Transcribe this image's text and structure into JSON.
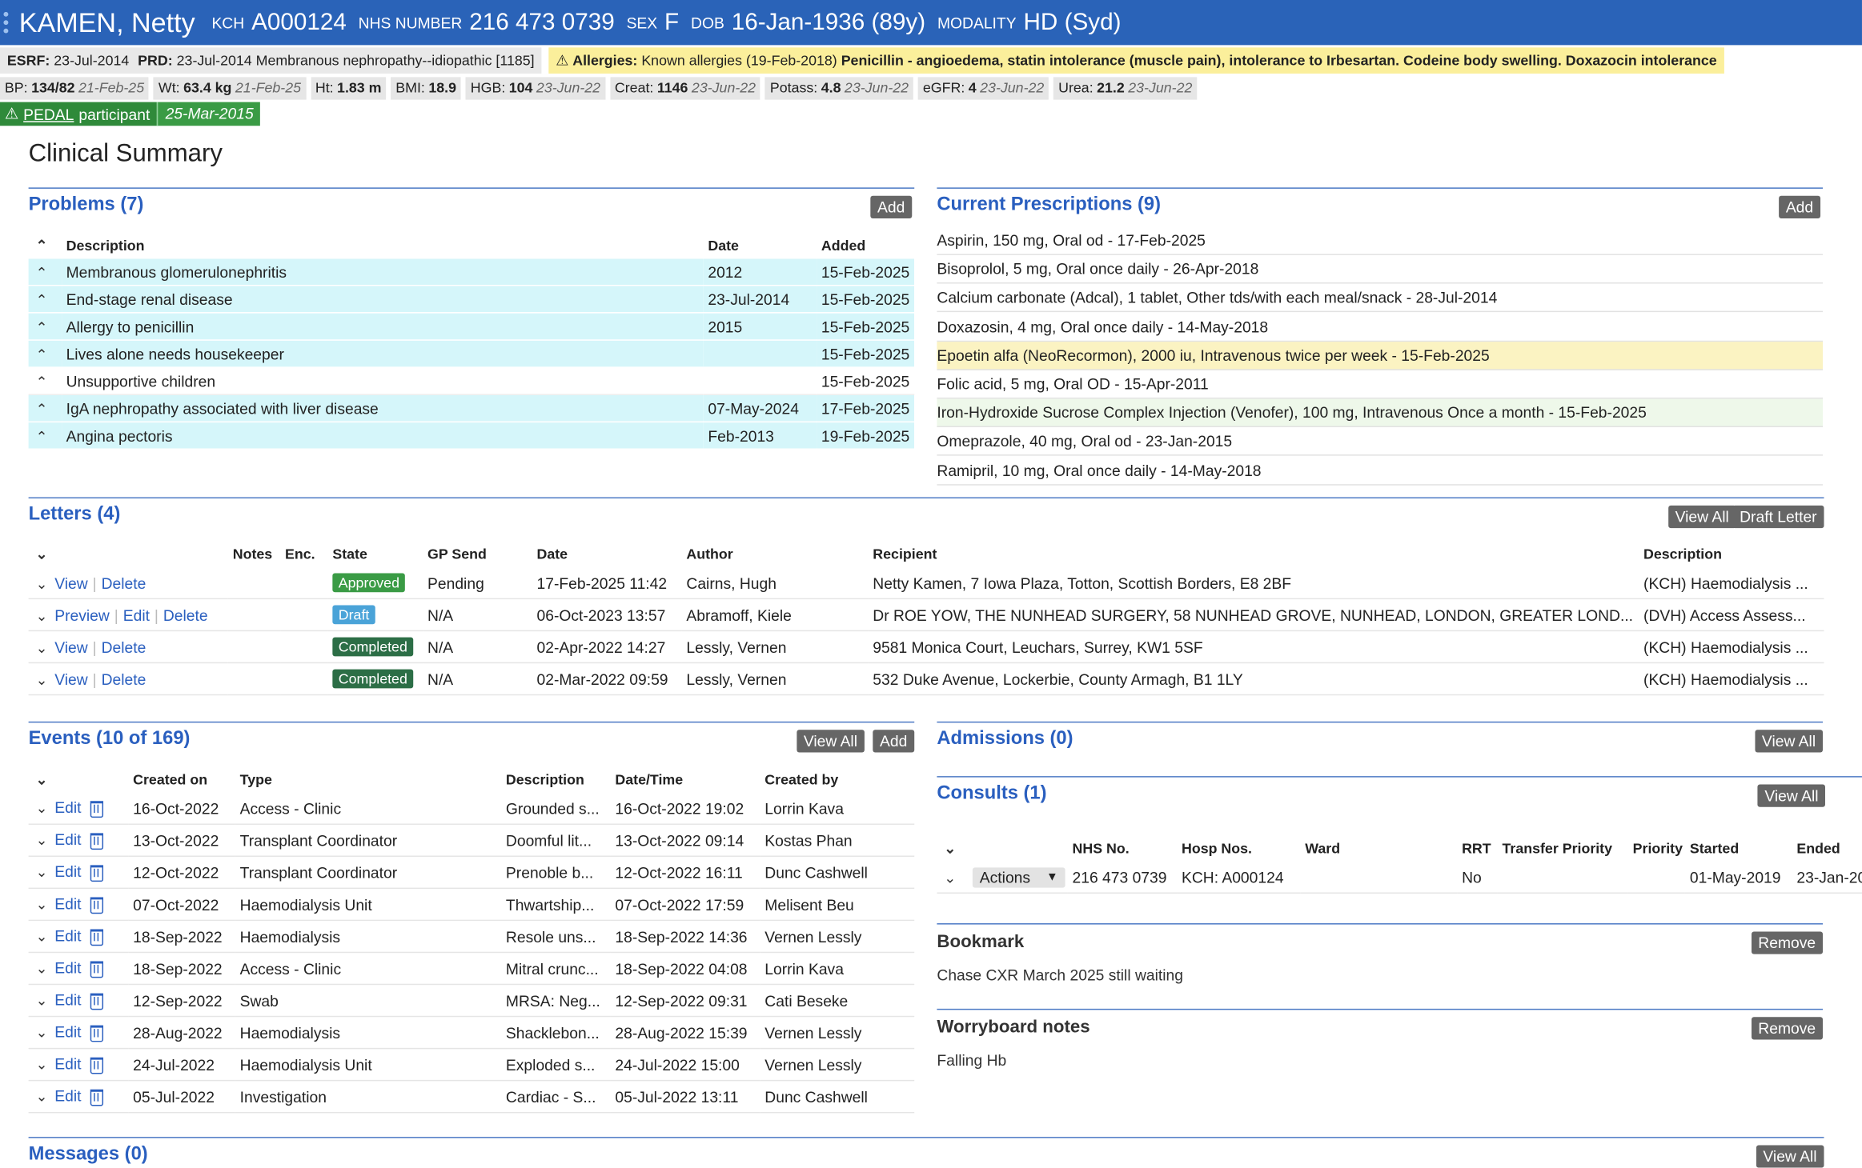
{
  "header": {
    "name": "KAMEN, Netty",
    "kch_label": "KCH",
    "kch_value": "A000124",
    "nhs_label": "NHS NUMBER",
    "nhs_value": "216 473 0739",
    "sex_label": "SEX",
    "sex_value": "F",
    "dob_label": "DOB",
    "dob_value": "16-Jan-1936 (89y)",
    "modality_label": "MODALITY",
    "modality_value": "HD (Syd)"
  },
  "info": {
    "esrf_label": "ESRF:",
    "esrf_value": "23-Jul-2014",
    "prd_label": "PRD:",
    "prd_value": "23-Jul-2014 Membranous nephropathy--idiopathic [1185]",
    "allergy_label": "Allergies:",
    "allergy_intro": "Known allergies (19-Feb-2018)",
    "allergy_text": "Penicillin - angioedema, statin intolerance (muscle pain), intolerance to Irbesartan. Codeine body swelling. Doxazocin intolerance"
  },
  "vitals": [
    {
      "label": "BP:",
      "value": "134/82",
      "date": "21-Feb-25"
    },
    {
      "label": "Wt:",
      "value": "63.4 kg",
      "date": "21-Feb-25"
    },
    {
      "label": "Ht:",
      "value": "1.83 m",
      "date": ""
    },
    {
      "label": "BMI:",
      "value": "18.9",
      "date": ""
    },
    {
      "label": "HGB:",
      "value": "104",
      "date": "23-Jun-22"
    },
    {
      "label": "Creat:",
      "value": "1146",
      "date": "23-Jun-22"
    },
    {
      "label": "Potass:",
      "value": "4.8",
      "date": "23-Jun-22"
    },
    {
      "label": "eGFR:",
      "value": "4",
      "date": "23-Jun-22"
    },
    {
      "label": "Urea:",
      "value": "21.2",
      "date": "23-Jun-22"
    }
  ],
  "pedal": {
    "link": "PEDAL",
    "text": "participant",
    "date": "25-Mar-2015"
  },
  "page_title": "Clinical Summary",
  "problems": {
    "title": "Problems (7)",
    "add_label": "Add",
    "headers": [
      "Description",
      "Date",
      "Added"
    ],
    "rows": [
      {
        "desc": "Membranous glomerulonephritis",
        "date": "2012",
        "added": "15-Feb-2025"
      },
      {
        "desc": "End-stage renal disease",
        "date": "23-Jul-2014",
        "added": "15-Feb-2025"
      },
      {
        "desc": "Allergy to penicillin",
        "date": "2015",
        "added": "15-Feb-2025"
      },
      {
        "desc": "Lives alone needs housekeeper",
        "date": "",
        "added": "15-Feb-2025"
      },
      {
        "desc": "Unsupportive children",
        "date": "",
        "added": "15-Feb-2025"
      },
      {
        "desc": "IgA nephropathy associated with liver disease",
        "date": "07-May-2024",
        "added": "17-Feb-2025"
      },
      {
        "desc": "Angina pectoris",
        "date": "Feb-2013",
        "added": "19-Feb-2025"
      }
    ]
  },
  "prescriptions": {
    "title": "Current Prescriptions (9)",
    "add_label": "Add",
    "items": [
      "Aspirin, 150 mg, Oral od - 17-Feb-2025",
      "Bisoprolol, 5 mg, Oral once daily - 26-Apr-2018",
      "Calcium carbonate (Adcal), 1 tablet, Other tds/with each meal/snack - 28-Jul-2014",
      "Doxazosin, 4 mg, Oral once daily - 14-May-2018",
      "Epoetin alfa (NeoRecormon), 2000 iu, Intravenous twice per week - 15-Feb-2025",
      "Folic acid, 5 mg, Oral OD - 15-Apr-2011",
      "Iron-Hydroxide Sucrose Complex Injection (Venofer), 100 mg, Intravenous Once a month - 15-Feb-2025",
      "Omeprazole, 40 mg, Oral od - 23-Jan-2015",
      "Ramipril, 10 mg, Oral once daily - 14-May-2018"
    ]
  },
  "letters": {
    "title": "Letters (4)",
    "view_all_label": "View All",
    "draft_label": "Draft Letter",
    "headers": [
      "Notes",
      "Enc.",
      "State",
      "GP Send",
      "Date",
      "Author",
      "Recipient",
      "Description"
    ],
    "rows": [
      {
        "actions": [
          "View",
          "Delete"
        ],
        "state": "Approved",
        "gp": "Pending",
        "date": "17-Feb-2025 11:42",
        "author": "Cairns, Hugh",
        "recipient": "Netty Kamen, 7 Iowa Plaza, Totton, Scottish Borders, E8 2BF",
        "desc": "(KCH) Haemodialysis ..."
      },
      {
        "actions": [
          "Preview",
          "Edit",
          "Delete"
        ],
        "state": "Draft",
        "gp": "N/A",
        "date": "06-Oct-2023 13:57",
        "author": "Abramoff, Kiele",
        "recipient": "Dr ROE YOW, THE NUNHEAD SURGERY, 58 NUNHEAD GROVE, NUNHEAD, LONDON, GREATER LOND...",
        "desc": "(DVH) Access Assess..."
      },
      {
        "actions": [
          "View",
          "Delete"
        ],
        "state": "Completed",
        "gp": "N/A",
        "date": "02-Apr-2022 14:27",
        "author": "Lessly, Vernen",
        "recipient": "9581 Monica Court, Leuchars, Surrey, KW1 5SF",
        "desc": "(KCH) Haemodialysis ..."
      },
      {
        "actions": [
          "View",
          "Delete"
        ],
        "state": "Completed",
        "gp": "N/A",
        "date": "02-Mar-2022 09:59",
        "author": "Lessly, Vernen",
        "recipient": "532 Duke Avenue, Lockerbie, County Armagh, B1 1LY",
        "desc": "(KCH) Haemodialysis ..."
      }
    ]
  },
  "events": {
    "title": "Events (10 of 169)",
    "view_all_label": "View All",
    "add_label": "Add",
    "edit_label": "Edit",
    "headers": [
      "Created on",
      "Type",
      "Description",
      "Date/Time",
      "Created by"
    ],
    "rows": [
      {
        "created": "16-Oct-2022",
        "type": "Access - Clinic",
        "desc": "Grounded s...",
        "dt": "16-Oct-2022 19:02",
        "by": "Lorrin Kava"
      },
      {
        "created": "13-Oct-2022",
        "type": "Transplant Coordinator",
        "desc": "Doomful lit...",
        "dt": "13-Oct-2022 09:14",
        "by": "Kostas Phan"
      },
      {
        "created": "12-Oct-2022",
        "type": "Transplant Coordinator",
        "desc": "Prenoble b...",
        "dt": "12-Oct-2022 16:11",
        "by": "Dunc Cashwell"
      },
      {
        "created": "07-Oct-2022",
        "type": "Haemodialysis Unit",
        "desc": "Thwartship...",
        "dt": "07-Oct-2022 17:59",
        "by": "Melisent Beu"
      },
      {
        "created": "18-Sep-2022",
        "type": "Haemodialysis",
        "desc": "Resole uns...",
        "dt": "18-Sep-2022 14:36",
        "by": "Vernen Lessly"
      },
      {
        "created": "18-Sep-2022",
        "type": "Access - Clinic",
        "desc": "Mitral crunc...",
        "dt": "18-Sep-2022 04:08",
        "by": "Lorrin Kava"
      },
      {
        "created": "12-Sep-2022",
        "type": "Swab",
        "desc": "MRSA: Neg...",
        "dt": "12-Sep-2022 09:31",
        "by": "Cati Beseke"
      },
      {
        "created": "28-Aug-2022",
        "type": "Haemodialysis",
        "desc": "Shacklebon...",
        "dt": "28-Aug-2022 15:39",
        "by": "Vernen Lessly"
      },
      {
        "created": "24-Jul-2022",
        "type": "Haemodialysis Unit",
        "desc": "Exploded s...",
        "dt": "24-Jul-2022 15:00",
        "by": "Vernen Lessly"
      },
      {
        "created": "05-Jul-2022",
        "type": "Investigation",
        "desc": "Cardiac - S...",
        "dt": "05-Jul-2022 13:11",
        "by": "Dunc Cashwell"
      }
    ]
  },
  "admissions": {
    "title": "Admissions (0)",
    "view_all_label": "View All"
  },
  "consults": {
    "title": "Consults (1)",
    "view_all_label": "View All",
    "headers": [
      "NHS No.",
      "Hosp Nos.",
      "Ward",
      "RRT",
      "Transfer Priority",
      "Priority",
      "Started",
      "Ended"
    ],
    "row": {
      "actions": "Actions",
      "nhs": "216 473 0739",
      "hosp": "KCH: A000124",
      "ward": "",
      "rrt": "No",
      "transfer": "",
      "priority": "",
      "started": "01-May-2019",
      "ended": "23-Jan-20"
    }
  },
  "bookmark": {
    "title": "Bookmark",
    "remove_label": "Remove",
    "text": "Chase CXR March 2025 still waiting"
  },
  "worryboard": {
    "title": "Worryboard notes",
    "remove_label": "Remove",
    "text": "Falling Hb"
  },
  "messages": {
    "title": "Messages (0)",
    "view_all_label": "View All"
  },
  "colors": {
    "header": "#2a63b8",
    "accent": "#2a5fbf",
    "problem_row": "#d5f6fa",
    "allergy": "#fbef9b"
  }
}
